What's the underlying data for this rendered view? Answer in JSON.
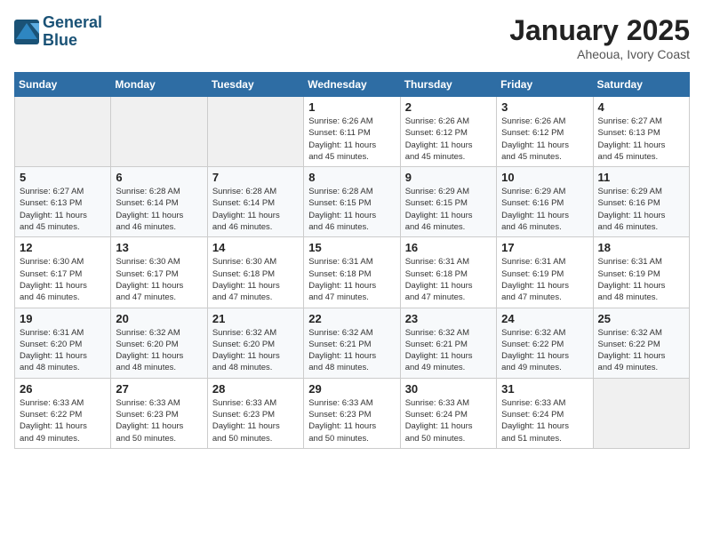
{
  "logo": {
    "line1": "General",
    "line2": "Blue"
  },
  "header": {
    "month": "January 2025",
    "location": "Aheoua, Ivory Coast"
  },
  "weekdays": [
    "Sunday",
    "Monday",
    "Tuesday",
    "Wednesday",
    "Thursday",
    "Friday",
    "Saturday"
  ],
  "weeks": [
    [
      {
        "day": "",
        "info": ""
      },
      {
        "day": "",
        "info": ""
      },
      {
        "day": "",
        "info": ""
      },
      {
        "day": "1",
        "info": "Sunrise: 6:26 AM\nSunset: 6:11 PM\nDaylight: 11 hours\nand 45 minutes."
      },
      {
        "day": "2",
        "info": "Sunrise: 6:26 AM\nSunset: 6:12 PM\nDaylight: 11 hours\nand 45 minutes."
      },
      {
        "day": "3",
        "info": "Sunrise: 6:26 AM\nSunset: 6:12 PM\nDaylight: 11 hours\nand 45 minutes."
      },
      {
        "day": "4",
        "info": "Sunrise: 6:27 AM\nSunset: 6:13 PM\nDaylight: 11 hours\nand 45 minutes."
      }
    ],
    [
      {
        "day": "5",
        "info": "Sunrise: 6:27 AM\nSunset: 6:13 PM\nDaylight: 11 hours\nand 45 minutes."
      },
      {
        "day": "6",
        "info": "Sunrise: 6:28 AM\nSunset: 6:14 PM\nDaylight: 11 hours\nand 46 minutes."
      },
      {
        "day": "7",
        "info": "Sunrise: 6:28 AM\nSunset: 6:14 PM\nDaylight: 11 hours\nand 46 minutes."
      },
      {
        "day": "8",
        "info": "Sunrise: 6:28 AM\nSunset: 6:15 PM\nDaylight: 11 hours\nand 46 minutes."
      },
      {
        "day": "9",
        "info": "Sunrise: 6:29 AM\nSunset: 6:15 PM\nDaylight: 11 hours\nand 46 minutes."
      },
      {
        "day": "10",
        "info": "Sunrise: 6:29 AM\nSunset: 6:16 PM\nDaylight: 11 hours\nand 46 minutes."
      },
      {
        "day": "11",
        "info": "Sunrise: 6:29 AM\nSunset: 6:16 PM\nDaylight: 11 hours\nand 46 minutes."
      }
    ],
    [
      {
        "day": "12",
        "info": "Sunrise: 6:30 AM\nSunset: 6:17 PM\nDaylight: 11 hours\nand 46 minutes."
      },
      {
        "day": "13",
        "info": "Sunrise: 6:30 AM\nSunset: 6:17 PM\nDaylight: 11 hours\nand 47 minutes."
      },
      {
        "day": "14",
        "info": "Sunrise: 6:30 AM\nSunset: 6:18 PM\nDaylight: 11 hours\nand 47 minutes."
      },
      {
        "day": "15",
        "info": "Sunrise: 6:31 AM\nSunset: 6:18 PM\nDaylight: 11 hours\nand 47 minutes."
      },
      {
        "day": "16",
        "info": "Sunrise: 6:31 AM\nSunset: 6:18 PM\nDaylight: 11 hours\nand 47 minutes."
      },
      {
        "day": "17",
        "info": "Sunrise: 6:31 AM\nSunset: 6:19 PM\nDaylight: 11 hours\nand 47 minutes."
      },
      {
        "day": "18",
        "info": "Sunrise: 6:31 AM\nSunset: 6:19 PM\nDaylight: 11 hours\nand 48 minutes."
      }
    ],
    [
      {
        "day": "19",
        "info": "Sunrise: 6:31 AM\nSunset: 6:20 PM\nDaylight: 11 hours\nand 48 minutes."
      },
      {
        "day": "20",
        "info": "Sunrise: 6:32 AM\nSunset: 6:20 PM\nDaylight: 11 hours\nand 48 minutes."
      },
      {
        "day": "21",
        "info": "Sunrise: 6:32 AM\nSunset: 6:20 PM\nDaylight: 11 hours\nand 48 minutes."
      },
      {
        "day": "22",
        "info": "Sunrise: 6:32 AM\nSunset: 6:21 PM\nDaylight: 11 hours\nand 48 minutes."
      },
      {
        "day": "23",
        "info": "Sunrise: 6:32 AM\nSunset: 6:21 PM\nDaylight: 11 hours\nand 49 minutes."
      },
      {
        "day": "24",
        "info": "Sunrise: 6:32 AM\nSunset: 6:22 PM\nDaylight: 11 hours\nand 49 minutes."
      },
      {
        "day": "25",
        "info": "Sunrise: 6:32 AM\nSunset: 6:22 PM\nDaylight: 11 hours\nand 49 minutes."
      }
    ],
    [
      {
        "day": "26",
        "info": "Sunrise: 6:33 AM\nSunset: 6:22 PM\nDaylight: 11 hours\nand 49 minutes."
      },
      {
        "day": "27",
        "info": "Sunrise: 6:33 AM\nSunset: 6:23 PM\nDaylight: 11 hours\nand 50 minutes."
      },
      {
        "day": "28",
        "info": "Sunrise: 6:33 AM\nSunset: 6:23 PM\nDaylight: 11 hours\nand 50 minutes."
      },
      {
        "day": "29",
        "info": "Sunrise: 6:33 AM\nSunset: 6:23 PM\nDaylight: 11 hours\nand 50 minutes."
      },
      {
        "day": "30",
        "info": "Sunrise: 6:33 AM\nSunset: 6:24 PM\nDaylight: 11 hours\nand 50 minutes."
      },
      {
        "day": "31",
        "info": "Sunrise: 6:33 AM\nSunset: 6:24 PM\nDaylight: 11 hours\nand 51 minutes."
      },
      {
        "day": "",
        "info": ""
      }
    ]
  ]
}
